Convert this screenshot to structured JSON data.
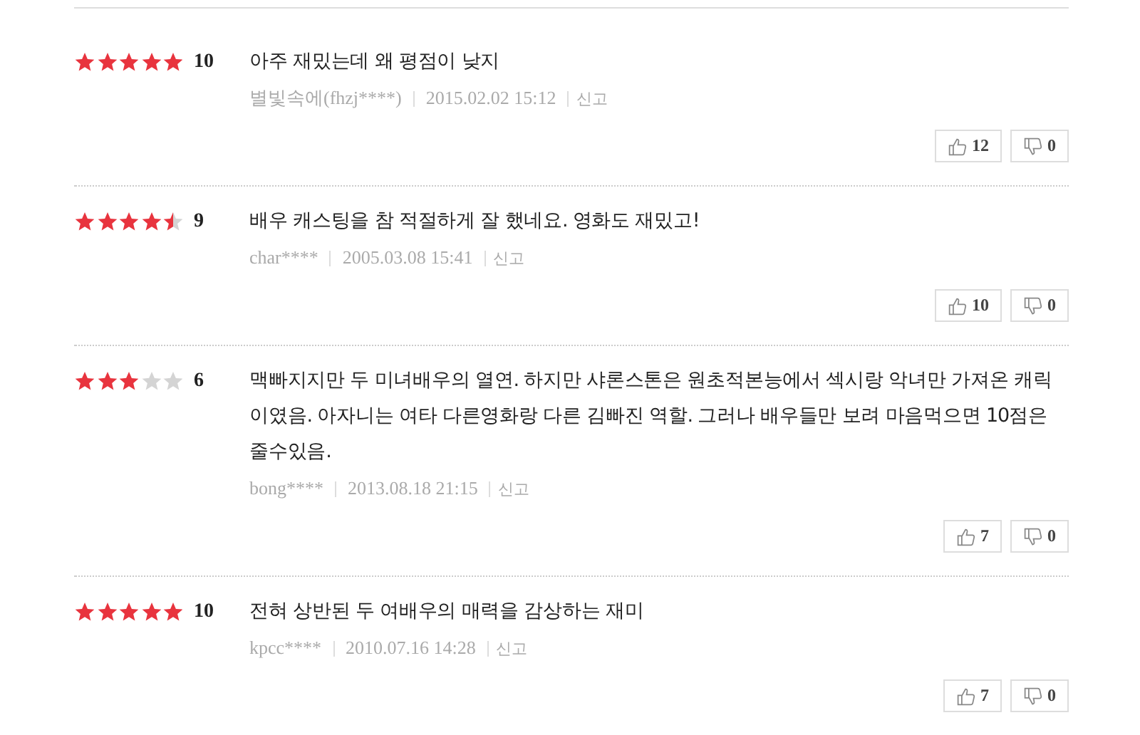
{
  "reviews": [
    {
      "stars": 5,
      "score": "10",
      "text": "아주 재밌는데 왜 평점이 낮지",
      "author": "별빛속에(fhzj****)",
      "date": "2015.02.02 15:12",
      "report": "신고",
      "likes": "12",
      "dislikes": "0"
    },
    {
      "stars": 4.5,
      "score": "9",
      "text": "배우 캐스팅을 참 적절하게 잘 했네요. 영화도 재밌고!",
      "author": "char****",
      "date": "2005.03.08 15:41",
      "report": "신고",
      "likes": "10",
      "dislikes": "0"
    },
    {
      "stars": 3,
      "score": "6",
      "text": "맥빠지지만 두 미녀배우의 열연. 하지만 샤론스톤은 원초적본능에서 섹시랑 악녀만 가져온 캐릭이였음. 아자니는 여타 다른영화랑 다른 김빠진 역할. 그러나 배우들만 보려 마음먹으면 10점은 줄수있음.",
      "author": "bong****",
      "date": "2013.08.18 21:15",
      "report": "신고",
      "likes": "7",
      "dislikes": "0"
    },
    {
      "stars": 5,
      "score": "10",
      "text": "전혀 상반된 두 여배우의 매력을 감상하는 재미",
      "author": "kpcc****",
      "date": "2010.07.16 14:28",
      "report": "신고",
      "likes": "7",
      "dislikes": "0"
    }
  ]
}
